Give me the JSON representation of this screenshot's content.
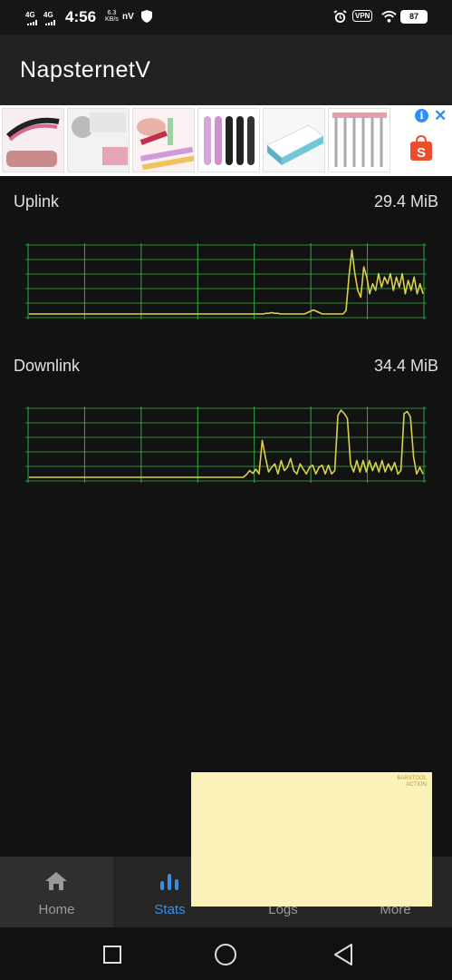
{
  "status_bar": {
    "net1": "4G",
    "net2": "4G",
    "time": "4:56",
    "speed_value": "6.3",
    "speed_unit": "KB/s",
    "nv_label": "nV",
    "vpn_label": "VPN",
    "battery": "87"
  },
  "app": {
    "title": "NapsternetV"
  },
  "stats": {
    "uplink_label": "Uplink",
    "uplink_value": "29.4 MiB",
    "downlink_label": "Downlink",
    "downlink_value": "34.4 MiB"
  },
  "chart_data": [
    {
      "type": "line",
      "name": "uplink",
      "values": [
        0,
        0,
        0,
        0,
        0,
        0,
        0,
        0,
        0,
        0,
        0,
        0,
        0,
        0,
        0,
        0,
        0,
        0,
        0,
        0,
        0,
        0,
        0,
        0,
        0,
        0,
        0,
        0,
        0,
        0,
        0,
        0,
        0,
        0,
        0,
        0,
        0,
        0,
        0,
        0,
        0,
        0,
        0,
        0,
        0,
        0,
        0,
        0,
        0,
        0,
        0,
        0,
        0,
        0,
        0,
        0,
        0,
        0,
        0,
        0,
        0,
        0,
        0,
        0,
        0,
        0,
        0,
        0,
        0,
        0,
        0,
        0,
        0,
        0,
        0,
        0,
        0,
        0,
        0,
        0,
        0.01,
        0.01,
        0.02,
        0.01,
        0.01,
        0,
        0,
        0,
        0,
        0,
        0,
        0,
        0,
        0,
        0.02,
        0.04,
        0.06,
        0.04,
        0.02,
        0,
        0,
        0,
        0,
        0,
        0,
        0,
        0,
        0.05,
        0.55,
        0.95,
        0.6,
        0.35,
        0.25,
        0.7,
        0.55,
        0.3,
        0.45,
        0.35,
        0.6,
        0.4,
        0.55,
        0.45,
        0.6,
        0.35,
        0.55,
        0.4,
        0.6,
        0.3,
        0.5,
        0.35,
        0.55,
        0.3,
        0.45,
        0.3
      ],
      "line_color": "#d8d24a",
      "grid_color": "#2fae3e"
    },
    {
      "type": "line",
      "name": "downlink",
      "values": [
        0,
        0,
        0,
        0,
        0,
        0,
        0,
        0,
        0,
        0,
        0,
        0,
        0,
        0,
        0,
        0,
        0,
        0,
        0,
        0,
        0,
        0,
        0,
        0,
        0,
        0,
        0,
        0,
        0,
        0,
        0,
        0,
        0,
        0,
        0,
        0,
        0,
        0,
        0,
        0,
        0,
        0,
        0,
        0,
        0,
        0,
        0,
        0,
        0,
        0,
        0,
        0,
        0,
        0,
        0,
        0,
        0,
        0,
        0,
        0,
        0,
        0,
        0,
        0,
        0,
        0,
        0,
        0,
        0,
        0.04,
        0.1,
        0.06,
        0.12,
        0.05,
        0.55,
        0.3,
        0.08,
        0.15,
        0.2,
        0.05,
        0.25,
        0.1,
        0.15,
        0.28,
        0.1,
        0.05,
        0.2,
        0.12,
        0.05,
        0.15,
        0.18,
        0.05,
        0.15,
        0.18,
        0.05,
        0.18,
        0.05,
        0.1,
        0.92,
        1.0,
        0.95,
        0.88,
        0.2,
        0.08,
        0.25,
        0.08,
        0.25,
        0.08,
        0.25,
        0.1,
        0.22,
        0.08,
        0.25,
        0.08,
        0.2,
        0.1,
        0.22,
        0.05,
        0.1,
        0.95,
        0.98,
        0.9,
        0.3,
        0.05,
        0.15,
        0.05
      ],
      "line_color": "#d8d24a",
      "grid_color": "#2fae3e"
    }
  ],
  "bottom_nav": {
    "home": "Home",
    "stats": "Stats",
    "logs": "Logs",
    "more": "More"
  },
  "float_ad": {
    "brand_line1": "BARSTOOL",
    "brand_line2": "ACTION"
  },
  "colors": {
    "accent": "#3b8fe0",
    "graph_line": "#d8d24a",
    "graph_grid": "#2fae3e"
  }
}
